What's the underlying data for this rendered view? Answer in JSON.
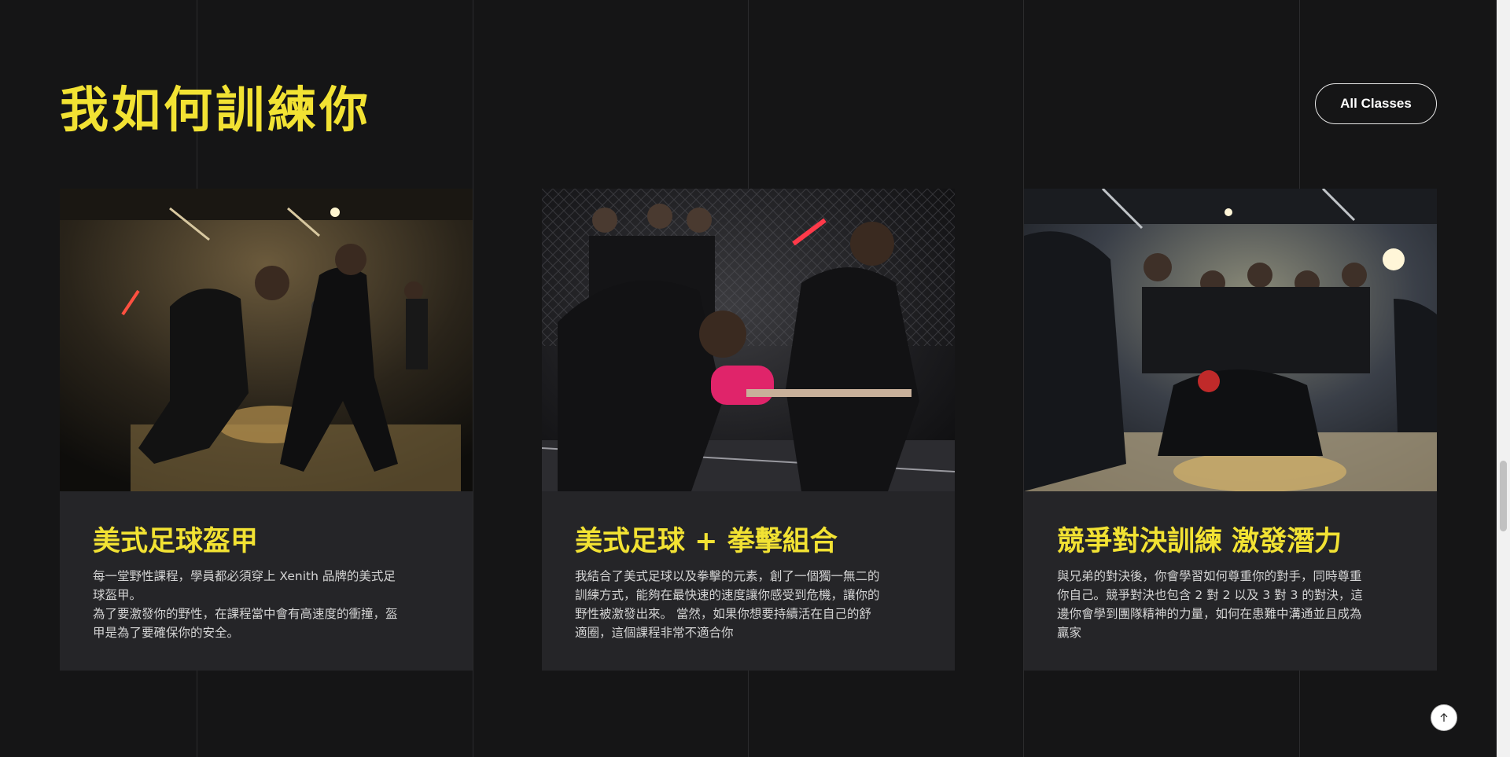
{
  "section": {
    "title": "我如何訓練你",
    "all_classes_label": "All Classes"
  },
  "cards": [
    {
      "title": "美式足球盔甲",
      "photo": "football-armor-training-photo",
      "desc": [
        "每一堂野性課程，學員都必須穿上 Xenith 品牌的美式足",
        "球盔甲。",
        "為了要激發你的野性，在課程當中會有高速度的衝撞，盔",
        "甲是為了要確保你的安全。"
      ]
    },
    {
      "title": "美式足球 + 拳擊組合",
      "photo": "football-boxing-combo-photo",
      "desc": [
        "我結合了美式足球以及拳擊的元素，創了一個獨一無二的",
        "訓練方式，能夠在最快速的速度讓你感受到危機，讓你的",
        "野性被激發出來。 當然，如果你想要持續活在自己的舒",
        "適圈，這個課程非常不適合你"
      ]
    },
    {
      "title": "競爭對決訓練 激發潛力",
      "photo": "competition-duel-training-photo",
      "desc": [
        "與兄弟的對決後，你會學習如何尊重你的對手，同時尊重",
        "你自己。競爭對決也包含 2 對 2 以及 3 對 3 的對決，這",
        "邊你會學到團隊精神的力量，如何在患難中溝通並且成為",
        "贏家"
      ]
    }
  ],
  "colors": {
    "background": "#151516",
    "accent_yellow": "#f2e233",
    "card_bg": "#252528"
  },
  "icons": {
    "back_to_top": "arrow-up-icon"
  }
}
